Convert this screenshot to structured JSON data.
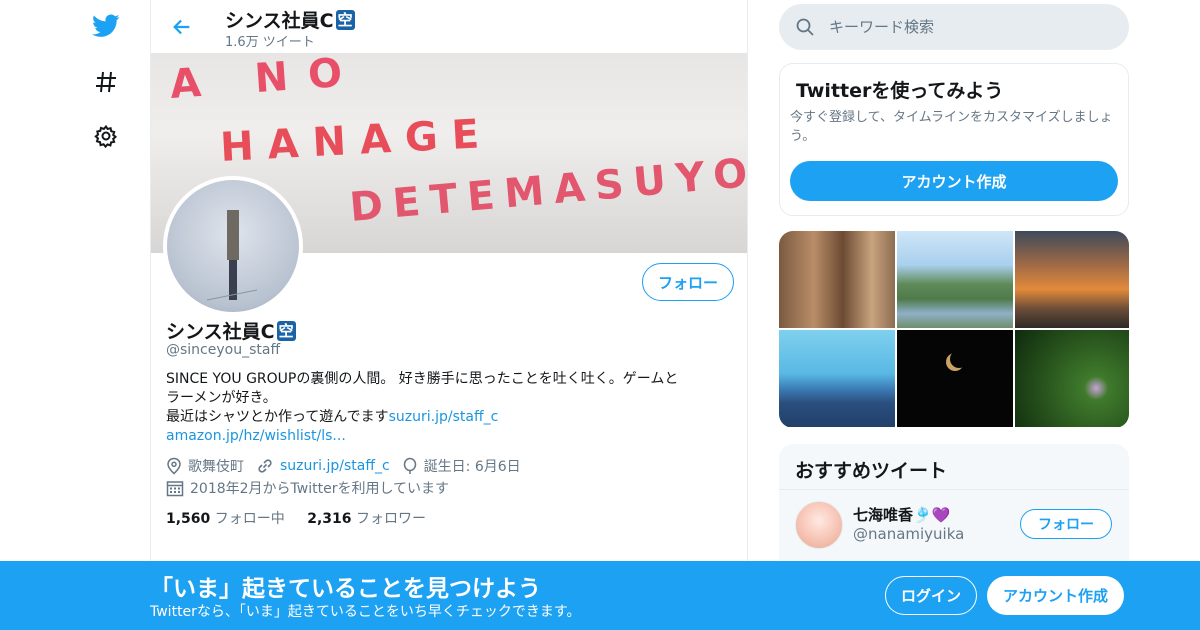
{
  "colors": {
    "accent": "#1da1f2",
    "link": "#1b95e0",
    "text": "#14171a",
    "muted": "#657786",
    "border": "#e6ecf0"
  },
  "header": {
    "name": "シンス社員C",
    "name_emoji": "空",
    "tweet_count": "1.6万 ツイート"
  },
  "banner": {
    "line1": "A NO",
    "line2": "HANAGE",
    "line3": "DETEMASUYO"
  },
  "profile": {
    "name": "シンス社員C",
    "name_emoji": "空",
    "handle": "@sinceyou_staff",
    "follow_label": "フォロー",
    "bio_line1": "SINCE YOU GROUPの裏側の人間。 好き勝手に思ったことを吐く吐く。ゲームと",
    "bio_line2": "ラーメンが好き。",
    "bio_line3": "最近はシャツとか作って遊んでます",
    "bio_link1": "suzuri.jp/staff_c",
    "bio_link2": "amazon.jp/hz/wishlist/ls...",
    "location": "歌舞伎町",
    "website": "suzuri.jp/staff_c",
    "birthday": "誕生日: 6月6日",
    "joined": "2018年2月からTwitterを利用しています",
    "following_count": "1,560",
    "following_label": "フォロー中",
    "followers_count": "2,316",
    "followers_label": "フォロワー"
  },
  "search": {
    "placeholder": "キーワード検索"
  },
  "signup_card": {
    "title": "Twitterを使ってみよう",
    "description": "今すぐ登録して、タイムラインをカスタマイズしましょう。",
    "button": "アカウント作成"
  },
  "photos": [
    "building-photo",
    "valley-photo",
    "sunset-photo",
    "sea-photo",
    "moon-photo",
    "flower-photo"
  ],
  "recommend": {
    "title": "おすすめツイート",
    "name": "七海唯香🎐💜",
    "handle": "@nanamiyuika",
    "follow_label": "フォロー"
  },
  "bottom_bar": {
    "title": "「いま」起きていることを見つけよう",
    "subtitle": "Twitterなら、「いま」起きていることをいち早くチェックできます。",
    "login": "ログイン",
    "signup": "アカウント作成"
  },
  "icons": [
    "twitter-bird-icon",
    "hashtag-icon",
    "gear-icon",
    "back-arrow-icon",
    "search-icon",
    "location-icon",
    "link-icon",
    "birthday-icon",
    "calendar-icon"
  ]
}
